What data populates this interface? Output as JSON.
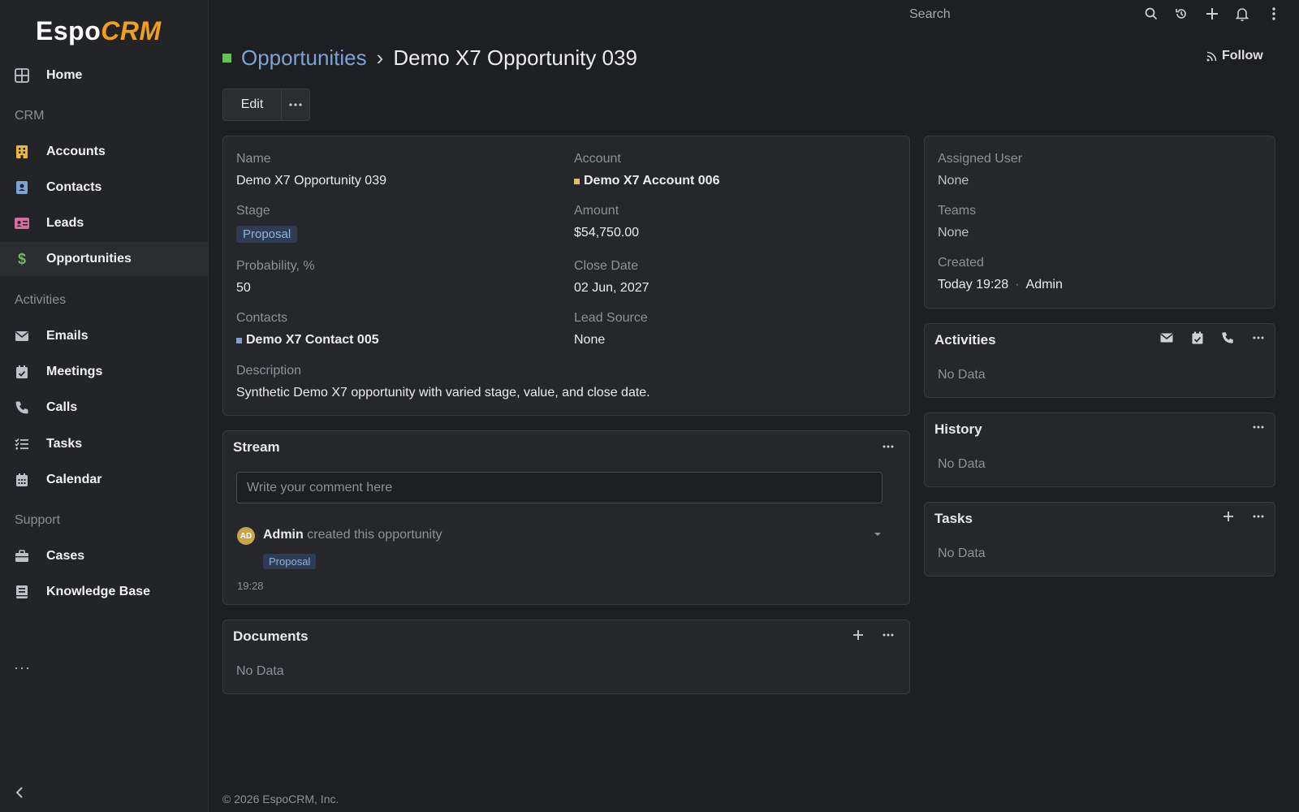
{
  "app": {
    "logo_text_1": "Espo",
    "logo_text_2": "CRM"
  },
  "sidebar": {
    "items": [
      {
        "label": "Home",
        "icon": "home-grid-icon"
      },
      {
        "label": "Accounts",
        "icon": "building-icon"
      },
      {
        "label": "Contacts",
        "icon": "contact-book-icon"
      },
      {
        "label": "Leads",
        "icon": "id-card-icon"
      },
      {
        "label": "Opportunities",
        "icon": "dollar-icon"
      },
      {
        "label": "Emails",
        "icon": "envelope-icon"
      },
      {
        "label": "Meetings",
        "icon": "calendar-check-icon"
      },
      {
        "label": "Calls",
        "icon": "phone-icon"
      },
      {
        "label": "Tasks",
        "icon": "task-list-icon"
      },
      {
        "label": "Calendar",
        "icon": "calendar-grid-icon"
      },
      {
        "label": "Cases",
        "icon": "briefcase-icon"
      },
      {
        "label": "Knowledge Base",
        "icon": "book-icon"
      }
    ],
    "sections": [
      "CRM",
      "Activities",
      "Support"
    ],
    "more": "···"
  },
  "topbar": {
    "search_placeholder": "Search"
  },
  "header": {
    "breadcrumb_parent": "Opportunities",
    "breadcrumb_sep": "›",
    "title": "Demo X7 Opportunity 039",
    "follow_label": "Follow",
    "edit_label": "Edit"
  },
  "detail": {
    "name_label": "Name",
    "name_value": "Demo X7 Opportunity 039",
    "account_label": "Account",
    "account_value": "Demo X7 Account 006",
    "stage_label": "Stage",
    "stage_value": "Proposal",
    "amount_label": "Amount",
    "amount_value": "$54,750.00",
    "probability_label": "Probability, %",
    "probability_value": "50",
    "close_date_label": "Close Date",
    "close_date_value": "02 Jun, 2027",
    "contacts_label": "Contacts",
    "contacts_value": "Demo X7 Contact 005",
    "lead_source_label": "Lead Source",
    "lead_source_value": "None",
    "description_label": "Description",
    "description_value": "Synthetic Demo X7 opportunity with varied stage, value, and close date."
  },
  "side_info": {
    "assigned_user_label": "Assigned User",
    "assigned_user_value": "None",
    "teams_label": "Teams",
    "teams_value": "None",
    "created_label": "Created",
    "created_date": "Today 19:28",
    "created_sep": "·",
    "created_by": "Admin"
  },
  "stream": {
    "title": "Stream",
    "comment_placeholder": "Write your comment here",
    "avatar_initials": "AD",
    "entry_user": "Admin",
    "entry_text": "created this opportunity",
    "entry_badge": "Proposal",
    "entry_time": "19:28"
  },
  "documents": {
    "title": "Documents",
    "no_data": "No Data"
  },
  "activities": {
    "title": "Activities",
    "no_data": "No Data"
  },
  "history": {
    "title": "History",
    "no_data": "No Data"
  },
  "tasks": {
    "title": "Tasks",
    "no_data": "No Data"
  },
  "footer": {
    "text": "© 2026 EspoCRM, Inc."
  },
  "colors": {
    "accent_link": "#7da2d9",
    "opportunity_square": "#6bbf59",
    "account_square": "#e0c05a",
    "contact_square": "#7da2d9",
    "badge_bg": "#2f3c52"
  }
}
